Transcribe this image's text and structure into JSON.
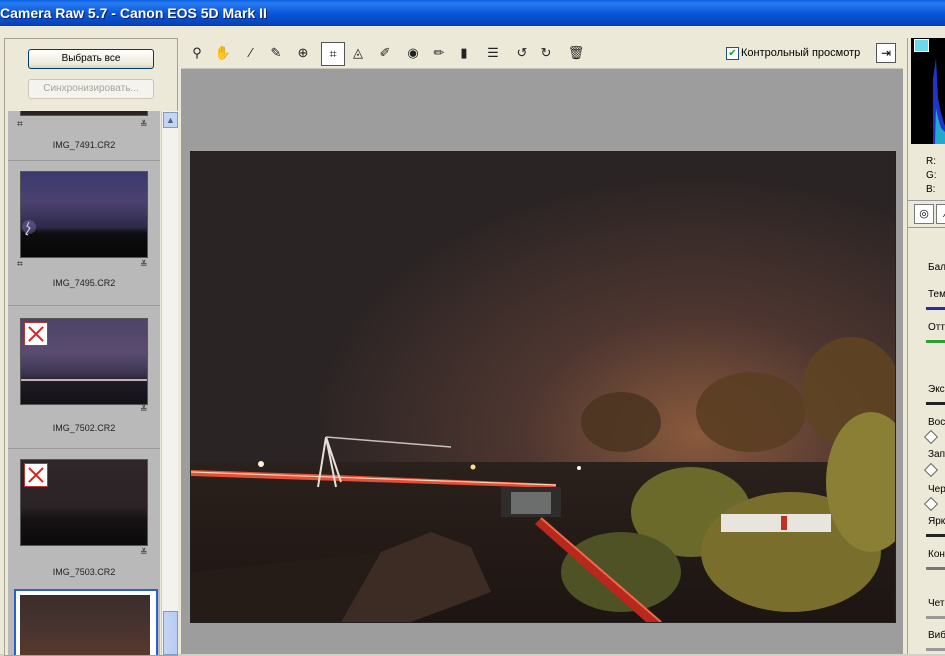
{
  "window": {
    "title": "Camera Raw 5.7  -  Canon EOS 5D Mark II"
  },
  "filmstrip": {
    "select_all_label": "Выбрать все",
    "synchronize_label": "Синхронизировать...",
    "items": [
      {
        "filename": "IMG_7491.CR2",
        "rejected": false
      },
      {
        "filename": "IMG_7495.CR2",
        "rejected": false
      },
      {
        "filename": "IMG_7502.CR2",
        "rejected": true
      },
      {
        "filename": "IMG_7503.CR2",
        "rejected": true
      }
    ]
  },
  "toolbar": {
    "tools": [
      "zoom-icon",
      "hand-icon",
      "white-balance-icon",
      "color-sampler-icon",
      "target-adjust-icon",
      "crop-icon",
      "straighten-icon",
      "spot-removal-icon",
      "red-eye-icon",
      "adjustment-brush-icon",
      "graduated-filter-icon",
      "preferences-icon",
      "rotate-left-icon",
      "rotate-right-icon",
      "trash-icon"
    ],
    "active_tool": "crop-icon",
    "preview_label": "Контрольный просмотр",
    "preview_checked": true
  },
  "right_panel": {
    "rgb": {
      "r": "R:",
      "g": "G:",
      "b": "B:"
    },
    "labels": {
      "white_balance": "Бал",
      "temperature": "Тем",
      "tint": "Отт",
      "exposure": "Экс",
      "recovery": "Вос",
      "fill_light": "Зап",
      "blacks": "Чер",
      "brightness": "Ярк",
      "contrast": "Кон",
      "clarity": "Чет",
      "vibrance": "Виб"
    }
  },
  "colors": {
    "accent": "#0a58d8",
    "selection": "#2c5fc8",
    "reject": "#e02020"
  }
}
